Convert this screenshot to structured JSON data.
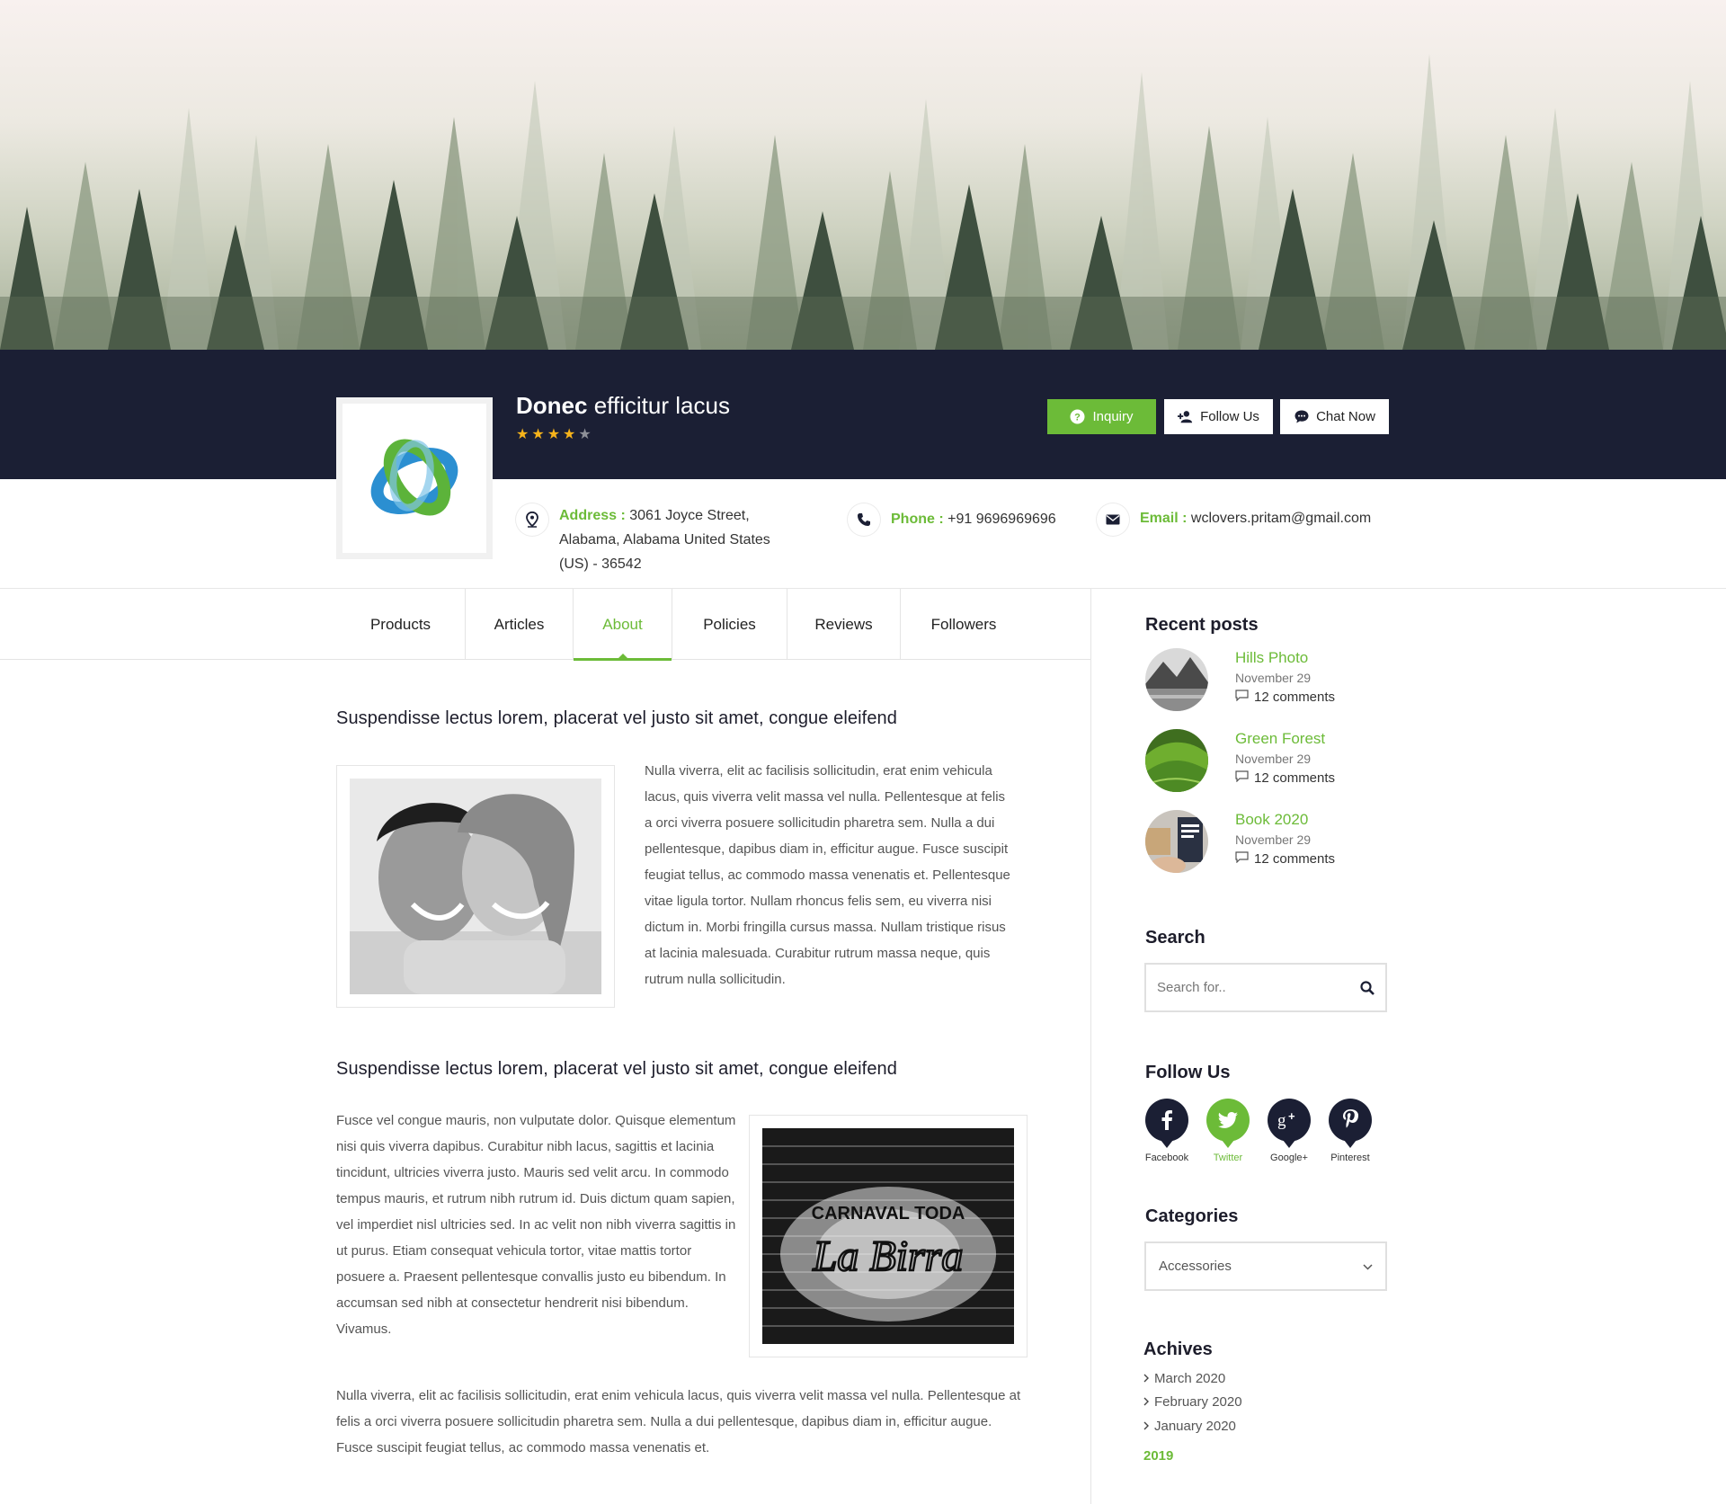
{
  "header": {
    "title_bold": "Donec",
    "title_rest": " efficitur lacus",
    "rating": 4,
    "rating_max": 5,
    "buttons": {
      "inquiry": "Inquiry",
      "follow": "Follow Us",
      "chat": "Chat Now"
    },
    "contact": {
      "address_label": "Address :",
      "address_value": " 3061 Joyce Street, Alabama, Alabama United States (US) - 36542",
      "phone_label": "Phone :",
      "phone_value": " +91 9696969696",
      "email_label": "Email :",
      "email_value": " wclovers.pritam@gmail.com"
    }
  },
  "tabs": [
    "Products",
    "Articles",
    "About",
    "Policies",
    "Reviews",
    "Followers"
  ],
  "active_tab": "About",
  "article": {
    "section1_heading": "Suspendisse lectus lorem, placerat vel justo sit amet, congue eleifend",
    "section1_text": "Nulla viverra, elit ac facilisis sollicitudin, erat enim vehicula lacus, quis viverra velit massa vel nulla. Pellentesque at felis a orci viverra posuere sollicitudin pharetra sem. Nulla a dui pellentesque, dapibus diam in, efficitur augue. Fusce suscipit feugiat tellus, ac commodo massa venenatis et. Pellentesque vitae ligula tortor. Nullam rhoncus felis sem, eu viverra nisi dictum in. Morbi fringilla cursus massa. Nullam tristique risus at lacinia malesuada. Curabitur rutrum massa neque, quis rutrum nulla sollicitudin.",
    "section2_heading": "Suspendisse lectus lorem, placerat vel justo sit amet, congue eleifend",
    "section2_text": "Fusce vel congue mauris, non vulputate dolor. Quisque elementum nisi quis viverra dapibus. Curabitur nibh lacus, sagittis et lacinia tincidunt, ultricies viverra justo. Mauris sed velit arcu. In commodo tempus mauris, et rutrum nibh rutrum id. Duis dictum quam sapien, vel imperdiet nisl ultricies sed. In ac velit non nibh viverra sagittis in ut purus. Etiam consequat vehicula tortor, vitae mattis tortor posuere a. Praesent pellentesque convallis justo eu bibendum. In accumsan sed nibh at consectetur hendrerit nisi bibendum. Vivamus.",
    "sign_line1": "CARNAVAL TODA",
    "sign_line2": "La Birra",
    "closing_text": "Nulla viverra, elit ac facilisis sollicitudin, erat enim vehicula lacus, quis viverra velit massa vel nulla. Pellentesque at felis a orci viverra posuere sollicitudin pharetra sem. Nulla a dui pellentesque, dapibus diam in, efficitur augue. Fusce suscipit feugiat tellus, ac commodo massa venenatis et."
  },
  "sidebar": {
    "recent_heading": "Recent posts",
    "posts": [
      {
        "title": "Hills Photo",
        "date": "November 29",
        "comments": "12 comments"
      },
      {
        "title": "Green Forest",
        "date": "November 29",
        "comments": "12 comments"
      },
      {
        "title": "Book 2020",
        "date": "November 29",
        "comments": "12 comments"
      }
    ],
    "search_heading": "Search",
    "search_placeholder": "Search for..",
    "follow_heading": "Follow Us",
    "socials": [
      {
        "name": "Facebook",
        "icon": "facebook-icon"
      },
      {
        "name": "Twitter",
        "icon": "twitter-icon"
      },
      {
        "name": "Google+",
        "icon": "google-plus-icon"
      },
      {
        "name": "Pinterest",
        "icon": "pinterest-icon"
      }
    ],
    "categories_heading": "Categories",
    "category_selected": "Accessories",
    "archives_heading": "Achives",
    "archives": [
      "March 2020",
      "February 2020",
      "January 2020"
    ],
    "archive_year": "2019"
  },
  "colors": {
    "accent": "#6cbb38",
    "dark": "#1b1f34",
    "star": "#f6b31b"
  }
}
